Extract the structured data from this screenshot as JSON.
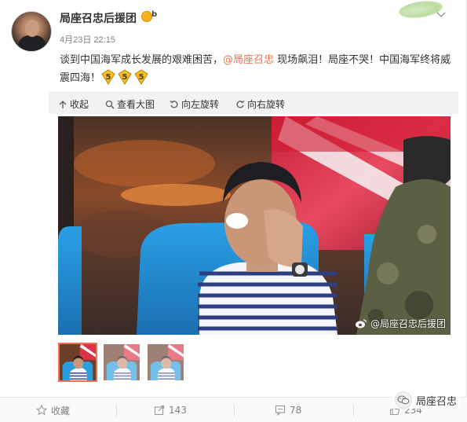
{
  "post": {
    "username": "局座召忠后援团",
    "time": "4月23日 22:15",
    "text_before": "谈到中国海军成长发展的艰难困苦，",
    "mention": "@局座召忠",
    "text_after": " 现场飙泪！局座不哭！中国海军终将威震四海！",
    "emoji_icon": "number-five-emoji",
    "emoji_count": 3
  },
  "toolbar": {
    "collapse_label": "收起",
    "view_large_label": "查看大图",
    "rotate_left_label": "向左旋转",
    "rotate_right_label": "向右旋转"
  },
  "image": {
    "watermark": "@局座召忠后援团"
  },
  "thumbnails": {
    "count": 3,
    "active_index": 0
  },
  "footer": {
    "favorite_label": "收藏",
    "share_count": "143",
    "comment_count": "78",
    "like_count": "234"
  },
  "overlay": {
    "account_name": "局座召忠"
  },
  "colors": {
    "mention": "#eb7350",
    "active_thumb": "#eb7350",
    "toolbar_bg": "#f2f2f5",
    "muted_text": "#808080"
  }
}
